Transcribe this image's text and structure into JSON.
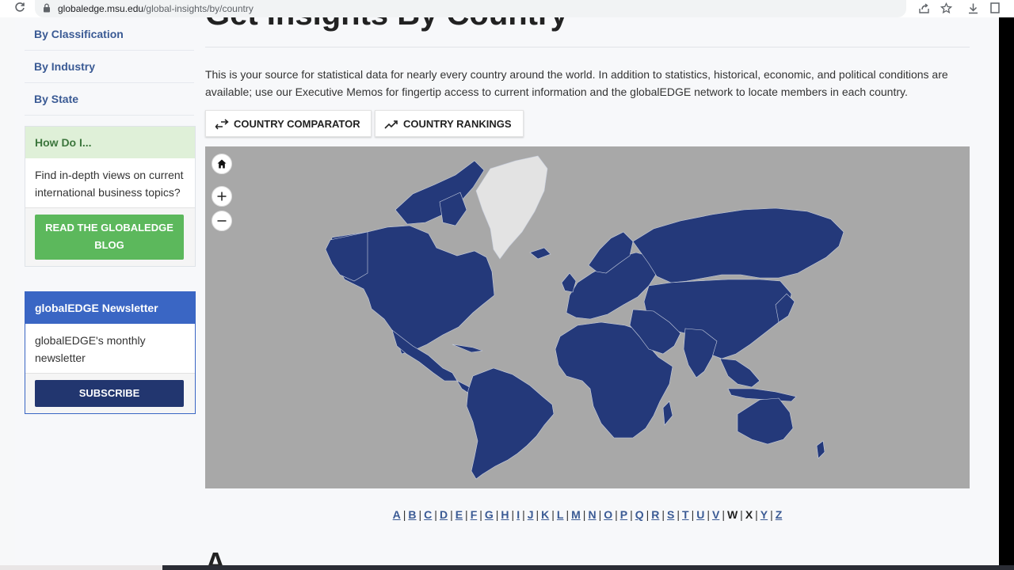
{
  "browser": {
    "url_host": "globaledge.msu.edu",
    "url_path": "/global-insights/by/country"
  },
  "sidebar": {
    "links": [
      "By Classification",
      "By Industry",
      "By State"
    ],
    "how_do_i": {
      "heading": "How Do I...",
      "text": "Find in-depth views on current international business topics?",
      "button_line1": "READ THE GLOBALEDGE",
      "button_line2": "BLOG"
    },
    "newsletter": {
      "heading": "globalEDGE Newsletter",
      "text": "globalEDGE's monthly newsletter",
      "button": "SUBSCRIBE"
    }
  },
  "main": {
    "title": "Get Insights By Country",
    "intro": "This is your source for statistical data for nearly every country around the world. In addition to statistics, historical, economic, and political conditions are available; use our Executive Memos for fingertip access to current information and the globalEDGE network to locate members in each country.",
    "buttons": {
      "comparator": "COUNTRY COMPARATOR",
      "rankings": "COUNTRY RANKINGS"
    },
    "map_colors": {
      "ocean": "#a8a8a8",
      "country": "#24397a",
      "greenland": "#e3e3e3"
    },
    "alphabet": [
      {
        "l": "A",
        "link": true
      },
      {
        "l": "B",
        "link": true
      },
      {
        "l": "C",
        "link": true
      },
      {
        "l": "D",
        "link": true
      },
      {
        "l": "E",
        "link": true
      },
      {
        "l": "F",
        "link": true
      },
      {
        "l": "G",
        "link": true
      },
      {
        "l": "H",
        "link": true
      },
      {
        "l": "I",
        "link": true
      },
      {
        "l": "J",
        "link": true
      },
      {
        "l": "K",
        "link": true
      },
      {
        "l": "L",
        "link": true
      },
      {
        "l": "M",
        "link": true
      },
      {
        "l": "N",
        "link": true
      },
      {
        "l": "O",
        "link": true
      },
      {
        "l": "P",
        "link": true
      },
      {
        "l": "Q",
        "link": true
      },
      {
        "l": "R",
        "link": true
      },
      {
        "l": "S",
        "link": true
      },
      {
        "l": "T",
        "link": true
      },
      {
        "l": "U",
        "link": true
      },
      {
        "l": "V",
        "link": true
      },
      {
        "l": "W",
        "link": false
      },
      {
        "l": "X",
        "link": false
      },
      {
        "l": "Y",
        "link": true
      },
      {
        "l": "Z",
        "link": true
      }
    ],
    "section_letter": "A"
  }
}
